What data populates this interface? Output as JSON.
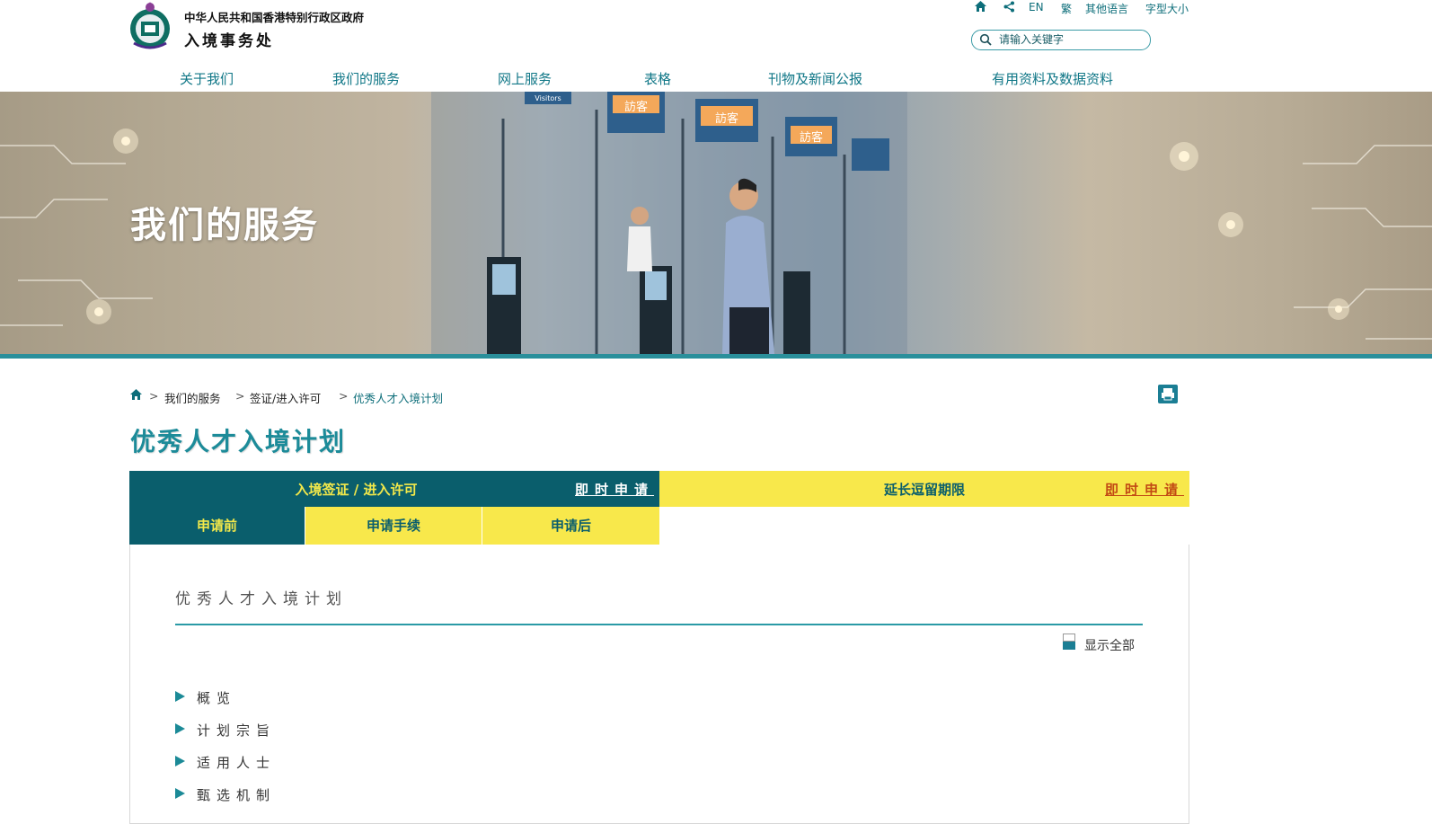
{
  "header": {
    "gov_name": "中华人民共和国香港特别行政区政府",
    "dept_name": "入境事务处",
    "utilities": {
      "lang_en": "EN",
      "lang_trad": "繁",
      "other_lang": "其他语言",
      "font_size": "字型大小"
    },
    "search": {
      "placeholder": "请输入关键字"
    }
  },
  "nav": [
    "关于我们",
    "我们的服务",
    "网上服务",
    "表格",
    "刊物及新闻公报",
    "有用资料及数据资料"
  ],
  "banner": {
    "title": "我们的服务",
    "signs": [
      "訪客",
      "訪客",
      "訪客",
      "Visitors"
    ]
  },
  "breadcrumb": {
    "items": [
      "我们的服务",
      "签证/进入许可",
      "优秀人才入境计划"
    ],
    "separator": ">"
  },
  "page_title": "优秀人才入境计划",
  "tabs": {
    "main": {
      "label": "入境签证 / 进入许可",
      "apply": "即时申请"
    },
    "extend": {
      "label": "延长逗留期限",
      "apply": "即时申请"
    },
    "subtabs": [
      "申请前",
      "申请手续",
      "申请后"
    ]
  },
  "content": {
    "section_title": "优秀人才入境计划",
    "show_all": "显示全部",
    "accordion": [
      "概览",
      "计划宗旨",
      "适用人士",
      "甄选机制"
    ]
  },
  "colors": {
    "teal_dark": "#0a5e6c",
    "teal": "#1c8b99",
    "yellow": "#f8e84b",
    "orange_link": "#c24a14"
  }
}
